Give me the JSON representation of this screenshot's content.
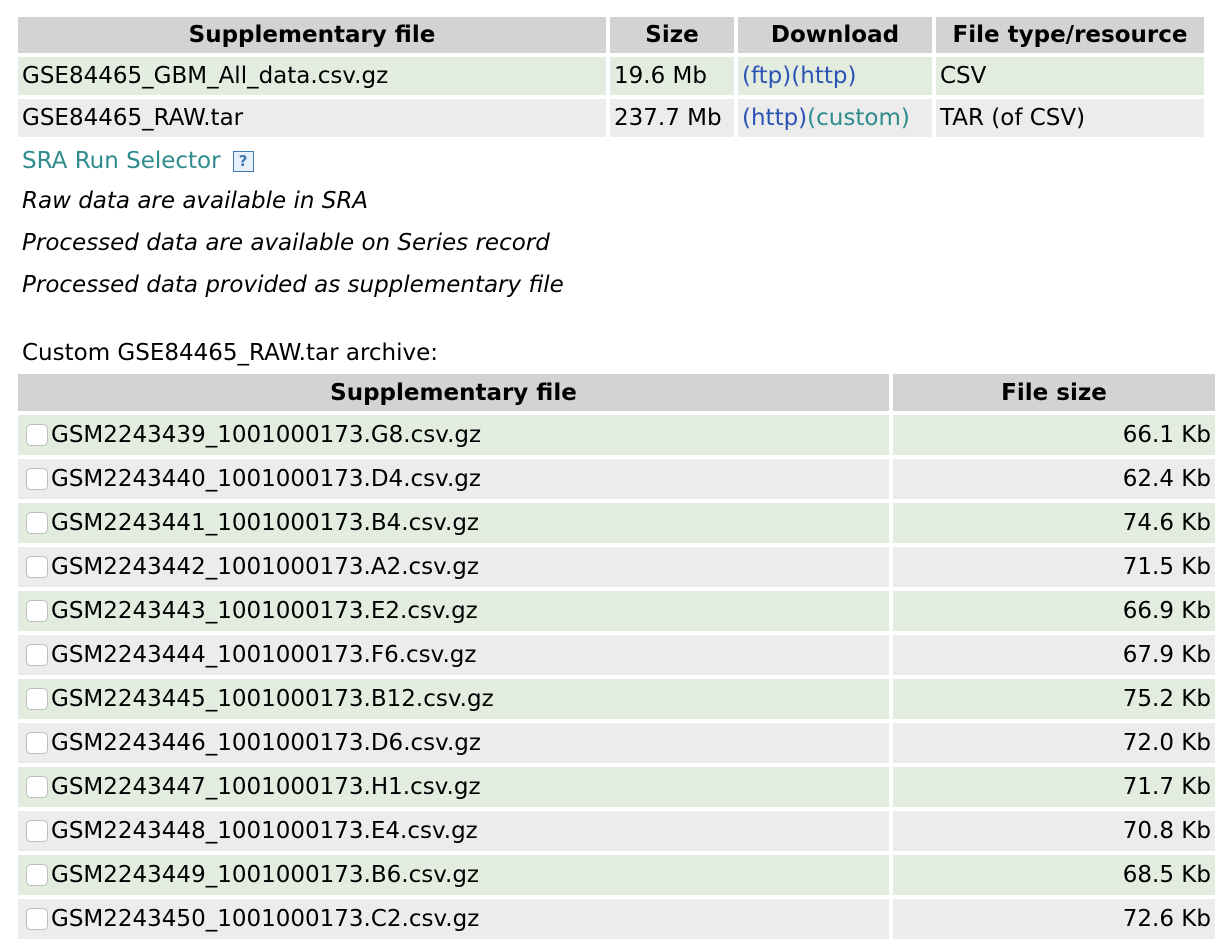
{
  "supplementary_table": {
    "headers": [
      "Supplementary file",
      "Size",
      "Download",
      "File type/resource"
    ],
    "rows": [
      {
        "file": "GSE84465_GBM_All_data.csv.gz",
        "size": "19.6 Mb",
        "link1": "(ftp)",
        "link2": "(http)",
        "type": "CSV"
      },
      {
        "file": "GSE84465_RAW.tar",
        "size": "237.7 Mb",
        "link1": "(http)",
        "link2": "(custom)",
        "type": "TAR (of CSV)"
      }
    ]
  },
  "sra": {
    "label": "SRA Run Selector",
    "help_icon": "?"
  },
  "notes": [
    "Raw data are available in SRA",
    "Processed data are available on Series record",
    "Processed data provided as supplementary file"
  ],
  "archive": {
    "label": "Custom GSE84465_RAW.tar archive:",
    "headers": [
      "Supplementary file",
      "File size"
    ],
    "rows": [
      {
        "file": "GSM2243439_1001000173.G8.csv.gz",
        "size": "66.1 Kb"
      },
      {
        "file": "GSM2243440_1001000173.D4.csv.gz",
        "size": "62.4 Kb"
      },
      {
        "file": "GSM2243441_1001000173.B4.csv.gz",
        "size": "74.6 Kb"
      },
      {
        "file": "GSM2243442_1001000173.A2.csv.gz",
        "size": "71.5 Kb"
      },
      {
        "file": "GSM2243443_1001000173.E2.csv.gz",
        "size": "66.9 Kb"
      },
      {
        "file": "GSM2243444_1001000173.F6.csv.gz",
        "size": "67.9 Kb"
      },
      {
        "file": "GSM2243445_1001000173.B12.csv.gz",
        "size": "75.2 Kb"
      },
      {
        "file": "GSM2243446_1001000173.D6.csv.gz",
        "size": "72.0 Kb"
      },
      {
        "file": "GSM2243447_1001000173.H1.csv.gz",
        "size": "71.7 Kb"
      },
      {
        "file": "GSM2243448_1001000173.E4.csv.gz",
        "size": "70.8 Kb"
      },
      {
        "file": "GSM2243449_1001000173.B6.csv.gz",
        "size": "68.5 Kb"
      },
      {
        "file": "GSM2243450_1001000173.C2.csv.gz",
        "size": "72.6 Kb"
      }
    ]
  }
}
